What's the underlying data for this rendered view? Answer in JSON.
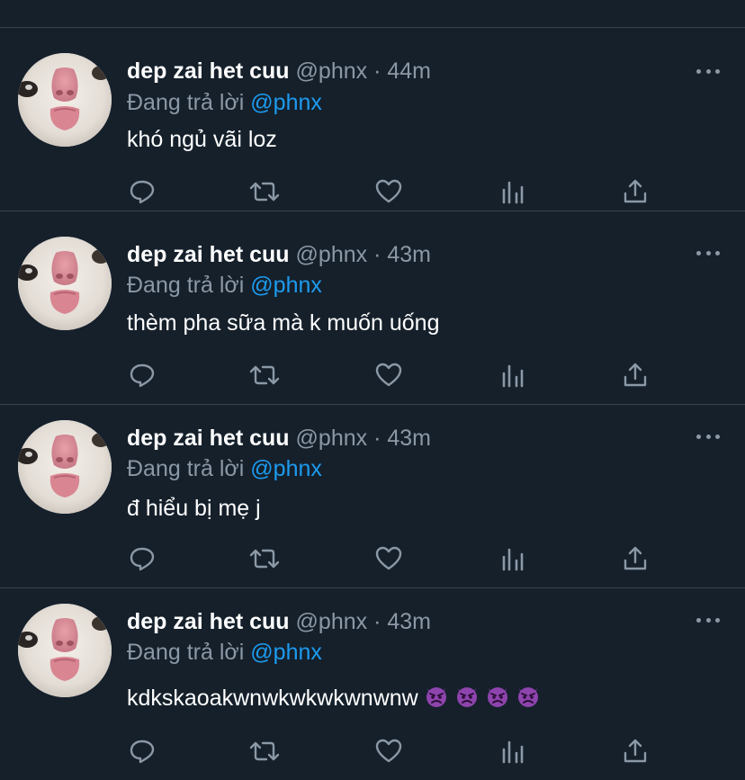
{
  "feed": {
    "tweets": [
      {
        "display_name": "dep zai het cuu",
        "handle": "@phnx",
        "separator": "·",
        "time": "44m",
        "reply_prefix": "Đang trả lời",
        "reply_to": "@phnx",
        "text": "khó ngủ vãi loz"
      },
      {
        "display_name": "dep zai het cuu",
        "handle": "@phnx",
        "separator": "·",
        "time": "43m",
        "reply_prefix": "Đang trả lời",
        "reply_to": "@phnx",
        "text": "thèm pha sữa mà k muốn uống"
      },
      {
        "display_name": "dep zai het cuu",
        "handle": "@phnx",
        "separator": "·",
        "time": "43m",
        "reply_prefix": "Đang trả lời",
        "reply_to": "@phnx",
        "text": "đ hiểu bị mẹ j"
      },
      {
        "display_name": "dep zai het cuu",
        "handle": "@phnx",
        "separator": "·",
        "time": "43m",
        "reply_prefix": "Đang trả lời",
        "reply_to": "@phnx",
        "text": "kdkskaoakwnwkwkwkwnwnw",
        "emojis": [
          "angry-devil-emoji",
          "angry-devil-emoji",
          "angry-devil-emoji",
          "angry-devil-emoji"
        ]
      }
    ],
    "action_icons": [
      "reply-icon",
      "retweet-icon",
      "like-icon",
      "analytics-icon",
      "share-icon"
    ]
  },
  "colors": {
    "background": "#15202b",
    "divider": "#38444d",
    "text_primary": "#ffffff",
    "text_secondary": "#8b98a5",
    "link": "#1d9bf0",
    "emoji": "#8e44ad"
  }
}
